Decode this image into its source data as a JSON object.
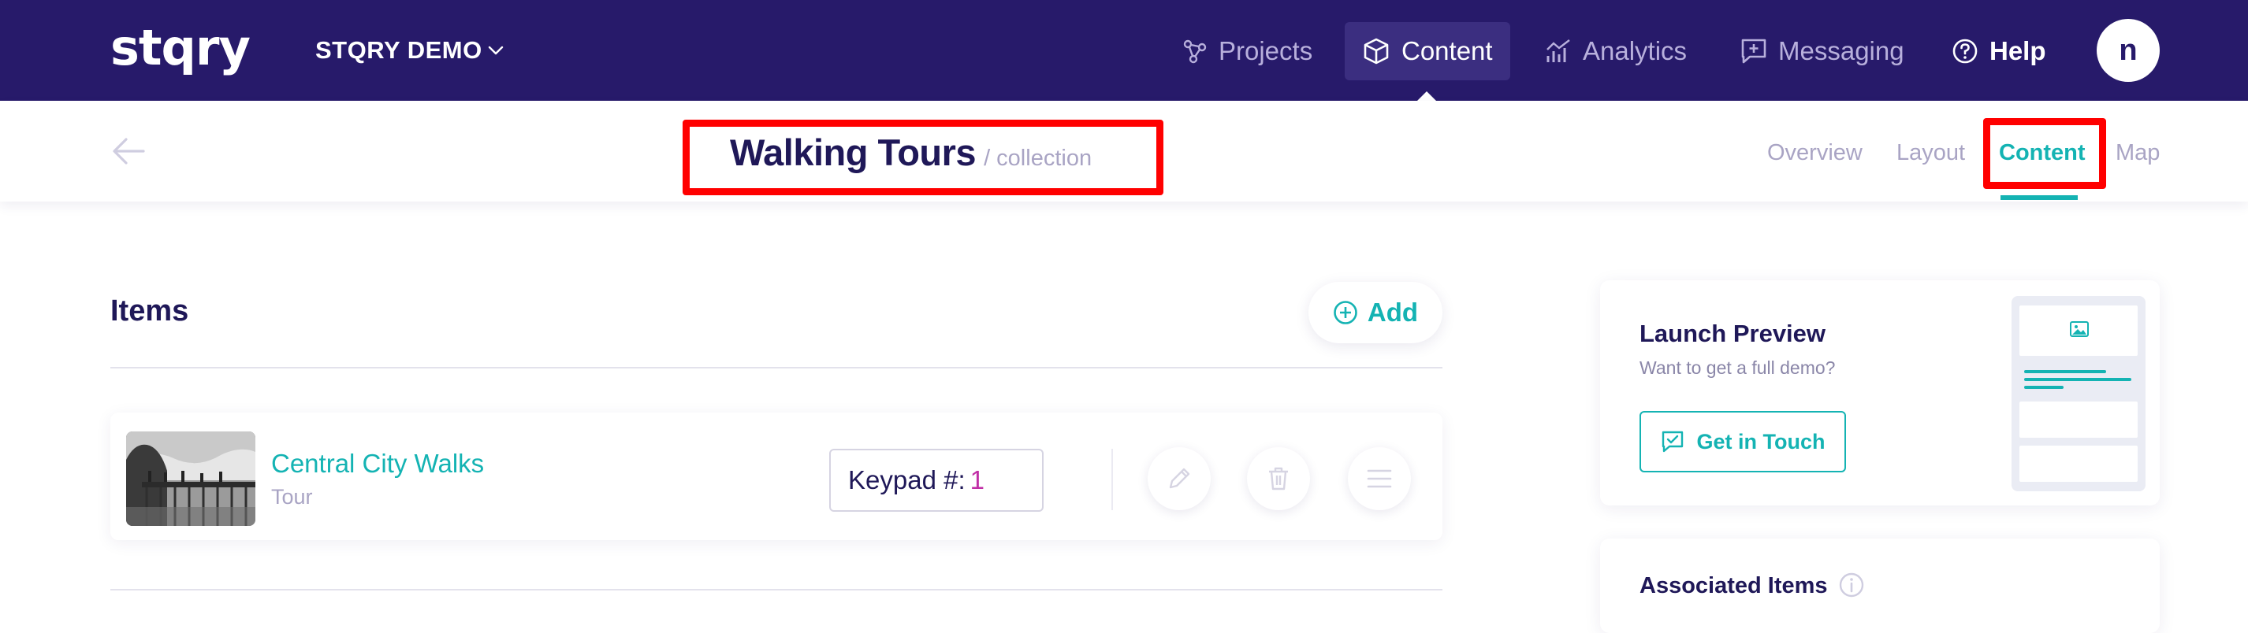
{
  "app": {
    "logo_text": "stqry",
    "org_name": "STQRY DEMO",
    "avatar_initial": "n"
  },
  "nav": {
    "items": [
      {
        "label": "Projects",
        "icon": "projects-icon",
        "active": false
      },
      {
        "label": "Content",
        "icon": "cube-icon",
        "active": true
      },
      {
        "label": "Analytics",
        "icon": "analytics-icon",
        "active": false
      },
      {
        "label": "Messaging",
        "icon": "message-icon",
        "active": false
      },
      {
        "label": "Help",
        "icon": "help-icon",
        "active": false
      }
    ]
  },
  "page": {
    "title": "Walking Tours",
    "subtitle": "/ collection",
    "tabs": [
      {
        "label": "Overview",
        "active": false
      },
      {
        "label": "Layout",
        "active": false
      },
      {
        "label": "Content",
        "active": true
      },
      {
        "label": "Map",
        "active": false
      }
    ],
    "highlight_color": "#ff0000"
  },
  "items_panel": {
    "title": "Items",
    "add_label": "Add",
    "rows": [
      {
        "name": "Central City Walks",
        "type": "Tour",
        "keypad_label": "Keypad #:",
        "keypad_value": "1"
      }
    ]
  },
  "launch_preview": {
    "title": "Launch Preview",
    "subtitle": "Want to get a full demo?",
    "button_label": "Get in Touch"
  },
  "associated_items": {
    "title": "Associated Items"
  },
  "colors": {
    "nav_bg": "#271a6a",
    "accent": "#14b3b3",
    "title_text": "#1f1858",
    "keypad_value": "#c12ea6"
  }
}
